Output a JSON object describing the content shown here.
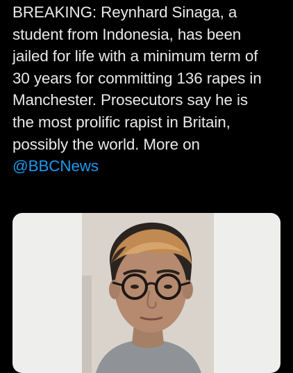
{
  "tweet": {
    "lines": [
      "BREAKING: Reynhard Sinaga, a",
      "student from Indonesia, has been",
      "jailed for life with a minimum term of",
      "30 years for committing 136 rapes in",
      "Manchester. Prosecutors say he is",
      "the most prolific rapist in Britain,",
      "possibly the world. More on"
    ],
    "mention": "@BBCNews"
  },
  "colors": {
    "background": "#000000",
    "text": "#e9e9ea",
    "mention": "#1d9bf0",
    "card_background": "#eeeeec"
  },
  "media": {
    "type": "photo",
    "subject": "mugshot-portrait"
  }
}
